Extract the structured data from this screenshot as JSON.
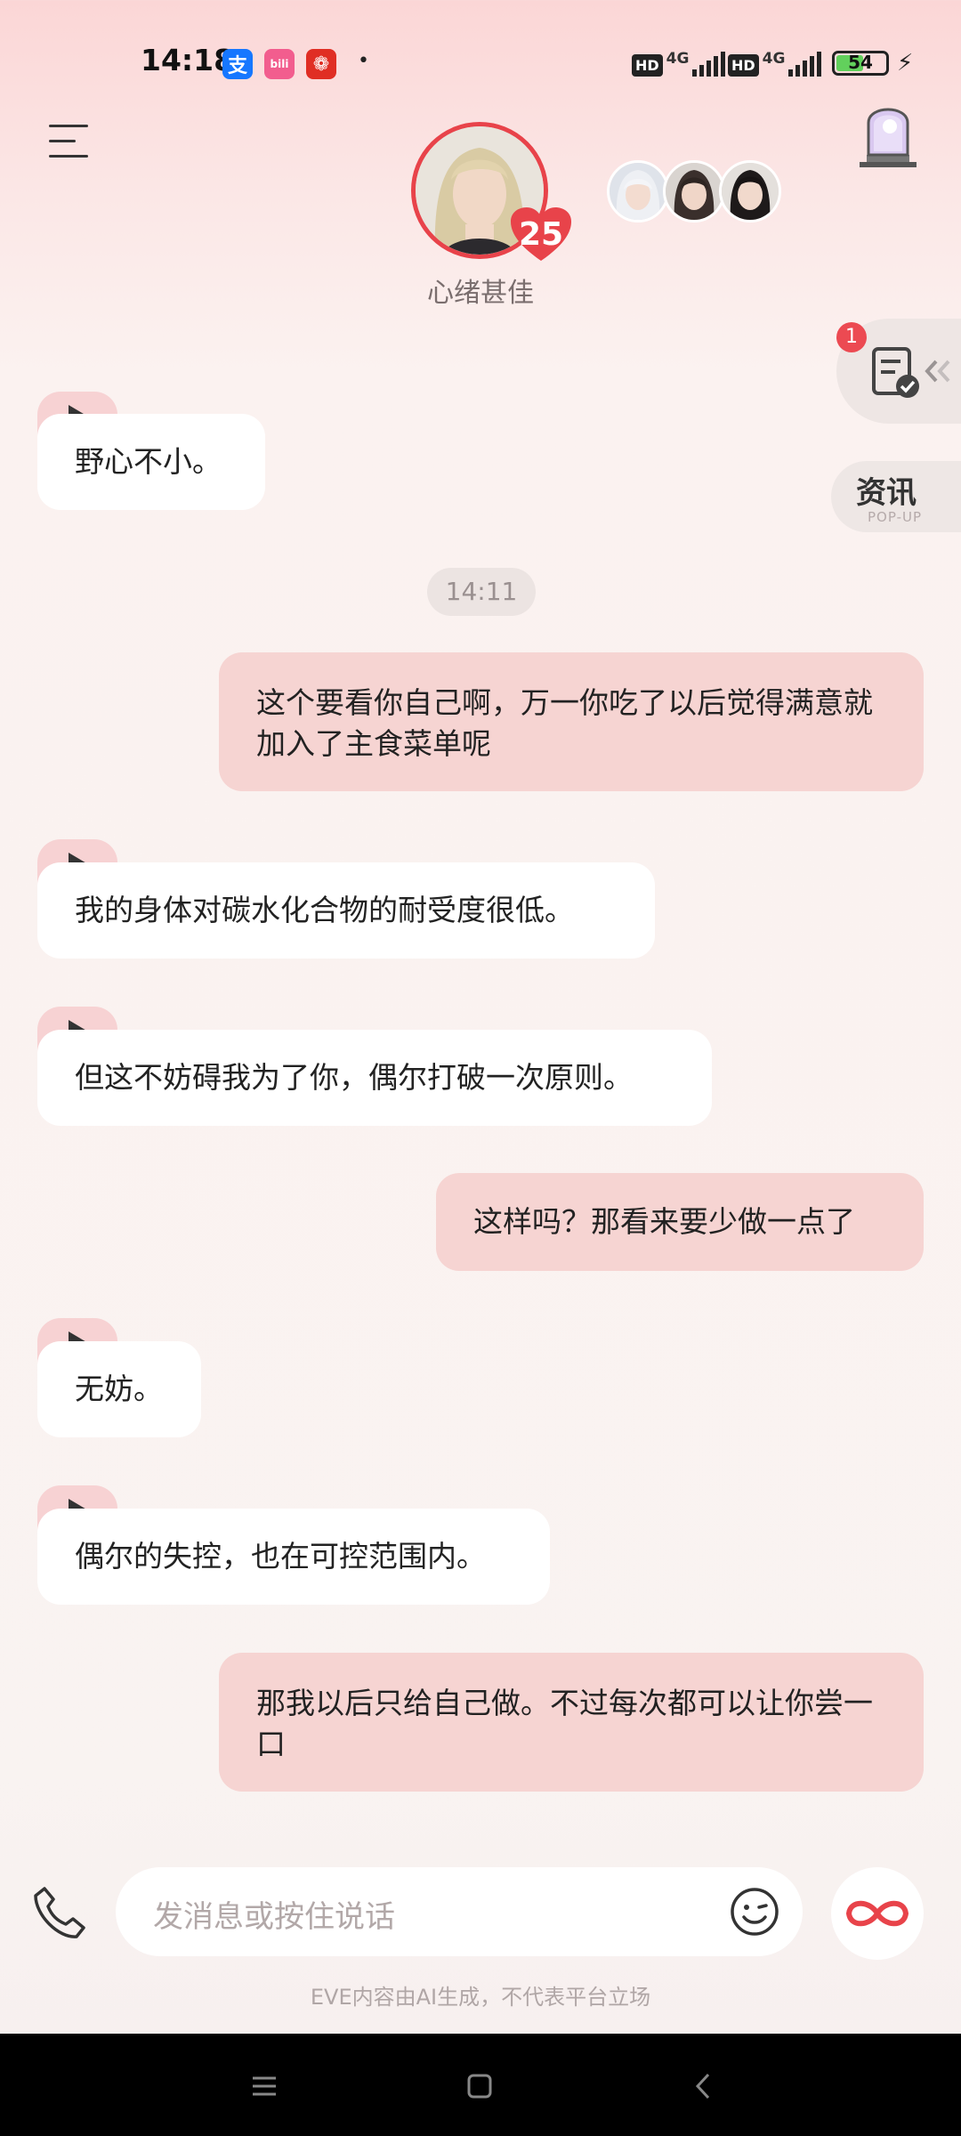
{
  "status_bar": {
    "time": "14:18",
    "app_icons": [
      {
        "name": "alipay-icon",
        "glyph": "支",
        "color": "#1677ff"
      },
      {
        "name": "bilibili-icon",
        "glyph": "bili",
        "color": "#f25d8e"
      },
      {
        "name": "gift-app-icon",
        "glyph": "❁",
        "color": "#e02e24"
      }
    ],
    "dot": "•",
    "hd_label": "HD",
    "network_label": "4G",
    "battery_level": "54",
    "charging_icon": "⚡"
  },
  "header": {
    "level": "25",
    "mood": "心绪甚佳",
    "menu_icon": "menu-icon",
    "door_icon": "portal-door-icon"
  },
  "side": {
    "task_badge": "1",
    "task_icon": "task-checklist-icon",
    "news_title": "资讯",
    "news_sub": "POP-UP"
  },
  "messages": [
    {
      "from": "ai",
      "text": "野心不小。"
    },
    {
      "from": "time",
      "text": "14:11"
    },
    {
      "from": "user",
      "text": "这个要看你自己啊，万一你吃了以后觉得满意就加入了主食菜单呢"
    },
    {
      "from": "ai",
      "text": "我的身体对碳水化合物的耐受度很低。"
    },
    {
      "from": "ai",
      "text": "但这不妨碍我为了你，偶尔打破一次原则。"
    },
    {
      "from": "user",
      "text": "这样吗？那看来要少做一点了"
    },
    {
      "from": "ai",
      "text": "无妨。"
    },
    {
      "from": "ai",
      "text": "偶尔的失控，也在可控范围内。"
    },
    {
      "from": "user",
      "text": "那我以后只给自己做。不过每次都可以让你尝一口"
    }
  ],
  "input": {
    "placeholder": "发消息或按住说话"
  },
  "disclaimer": "EVE内容由AI生成，不代表平台立场",
  "colors": {
    "accent": "#e8434a",
    "user_bubble": "#f6d4d2",
    "ai_bubble": "#ffffff"
  }
}
